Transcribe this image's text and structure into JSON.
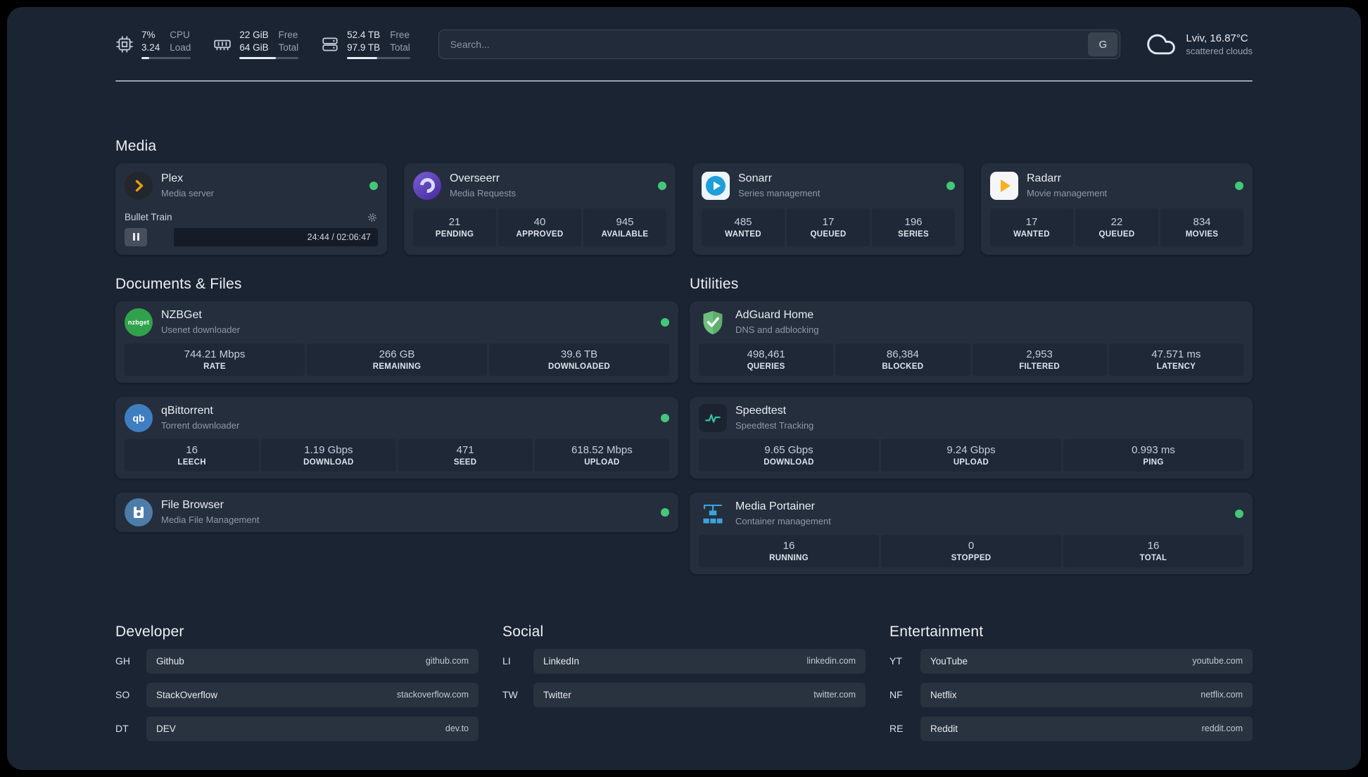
{
  "colors": {
    "status_ok": "#43c879",
    "accent_amber": "#e5a00d",
    "background": "#1b2433",
    "card": "#252e3d"
  },
  "topbar": {
    "cpu": {
      "icon": "cpu-chip-icon",
      "value_top": "7%",
      "value_bottom": "3.24",
      "label_top": "CPU",
      "label_bottom": "Load",
      "bar_percent": 15
    },
    "memory": {
      "icon": "memory-icon",
      "value_top": "22 GiB",
      "value_bottom": "64 GiB",
      "label_top": "Free",
      "label_bottom": "Total",
      "bar_percent": 62
    },
    "disk": {
      "icon": "disk-icon",
      "value_top": "52.4 TB",
      "value_bottom": "97.9 TB",
      "label_top": "Free",
      "label_bottom": "Total",
      "bar_percent": 48
    },
    "search": {
      "placeholder": "Search...",
      "button_label": "G"
    },
    "weather": {
      "icon": "cloud-icon",
      "location": "Lviv, 16.87°C",
      "condition": "scattered clouds"
    }
  },
  "media": {
    "title": "Media",
    "plex": {
      "name": "Plex",
      "subtitle": "Media server",
      "now_playing": {
        "title": "Bullet Train",
        "time": "24:44 / 02:06:47",
        "progress_percent": 19.5
      }
    },
    "overseerr": {
      "name": "Overseerr",
      "subtitle": "Media Requests",
      "stats": [
        {
          "value": "21",
          "label": "PENDING"
        },
        {
          "value": "40",
          "label": "APPROVED"
        },
        {
          "value": "945",
          "label": "AVAILABLE"
        }
      ]
    },
    "sonarr": {
      "name": "Sonarr",
      "subtitle": "Series management",
      "stats": [
        {
          "value": "485",
          "label": "WANTED"
        },
        {
          "value": "17",
          "label": "QUEUED"
        },
        {
          "value": "196",
          "label": "SERIES"
        }
      ]
    },
    "radarr": {
      "name": "Radarr",
      "subtitle": "Movie management",
      "stats": [
        {
          "value": "17",
          "label": "WANTED"
        },
        {
          "value": "22",
          "label": "QUEUED"
        },
        {
          "value": "834",
          "label": "MOVIES"
        }
      ]
    }
  },
  "documents": {
    "title": "Documents & Files",
    "nzbget": {
      "name": "NZBGet",
      "subtitle": "Usenet downloader",
      "stats": [
        {
          "value": "744.21 Mbps",
          "label": "RATE"
        },
        {
          "value": "266 GB",
          "label": "REMAINING"
        },
        {
          "value": "39.6 TB",
          "label": "DOWNLOADED"
        }
      ]
    },
    "qbittorrent": {
      "name": "qBittorrent",
      "subtitle": "Torrent downloader",
      "stats": [
        {
          "value": "16",
          "label": "LEECH"
        },
        {
          "value": "1.19 Gbps",
          "label": "DOWNLOAD"
        },
        {
          "value": "471",
          "label": "SEED"
        },
        {
          "value": "618.52 Mbps",
          "label": "UPLOAD"
        }
      ]
    },
    "filebrowser": {
      "name": "File Browser",
      "subtitle": "Media File Management"
    }
  },
  "utilities": {
    "title": "Utilities",
    "adguard": {
      "name": "AdGuard Home",
      "subtitle": "DNS and adblocking",
      "stats": [
        {
          "value": "498,461",
          "label": "QUERIES"
        },
        {
          "value": "86,384",
          "label": "BLOCKED"
        },
        {
          "value": "2,953",
          "label": "FILTERED"
        },
        {
          "value": "47.571 ms",
          "label": "LATENCY"
        }
      ]
    },
    "speedtest": {
      "name": "Speedtest",
      "subtitle": "Speedtest Tracking",
      "stats": [
        {
          "value": "9.65 Gbps",
          "label": "DOWNLOAD"
        },
        {
          "value": "9.24 Gbps",
          "label": "UPLOAD"
        },
        {
          "value": "0.993 ms",
          "label": "PING"
        }
      ]
    },
    "portainer": {
      "name": "Media Portainer",
      "subtitle": "Container management",
      "stats": [
        {
          "value": "16",
          "label": "RUNNING"
        },
        {
          "value": "0",
          "label": "STOPPED"
        },
        {
          "value": "16",
          "label": "TOTAL"
        }
      ]
    }
  },
  "bookmarks": {
    "developer": {
      "title": "Developer",
      "items": [
        {
          "abbr": "GH",
          "name": "Github",
          "url": "github.com"
        },
        {
          "abbr": "SO",
          "name": "StackOverflow",
          "url": "stackoverflow.com"
        },
        {
          "abbr": "DT",
          "name": "DEV",
          "url": "dev.to"
        }
      ]
    },
    "social": {
      "title": "Social",
      "items": [
        {
          "abbr": "LI",
          "name": "LinkedIn",
          "url": "linkedin.com"
        },
        {
          "abbr": "TW",
          "name": "Twitter",
          "url": "twitter.com"
        }
      ]
    },
    "entertainment": {
      "title": "Entertainment",
      "items": [
        {
          "abbr": "YT",
          "name": "YouTube",
          "url": "youtube.com"
        },
        {
          "abbr": "NF",
          "name": "Netflix",
          "url": "netflix.com"
        },
        {
          "abbr": "RE",
          "name": "Reddit",
          "url": "reddit.com"
        }
      ]
    }
  },
  "nzbget_icon_text": "nzbget",
  "qbit_icon_text": "qb"
}
